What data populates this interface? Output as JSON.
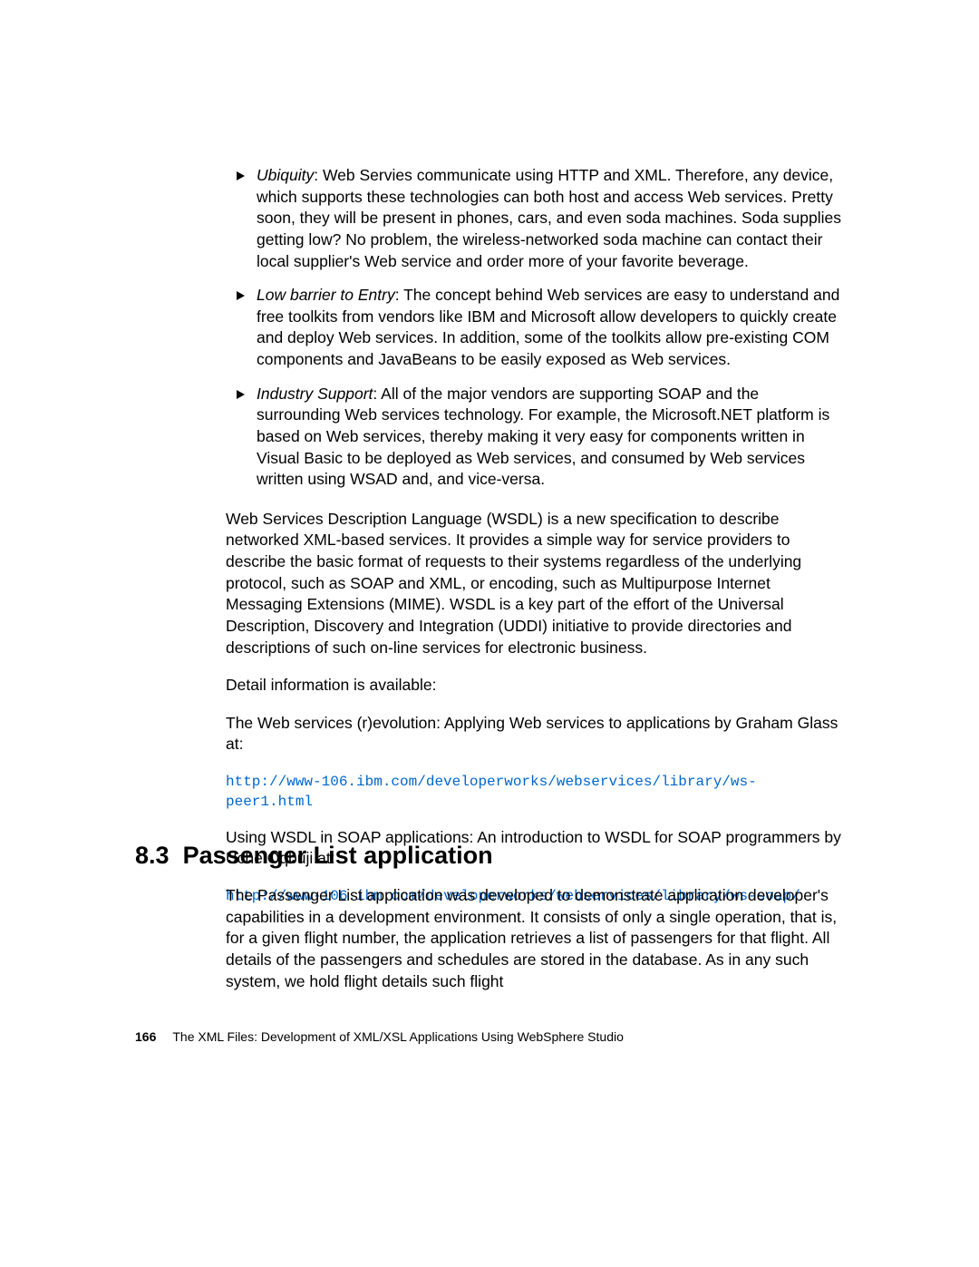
{
  "bullets": [
    {
      "term": "Ubiquity",
      "text": ": Web Servies communicate using HTTP and XML. Therefore, any device, which supports these technologies can both host and access Web services. Pretty soon, they will be present in phones, cars, and even soda machines. Soda supplies getting low? No problem, the wireless-networked soda machine can contact their local supplier's Web service and order more of your favorite beverage."
    },
    {
      "term": "Low barrier to Entry",
      "text": ": The concept behind Web services are easy to understand and free toolkits from vendors like IBM and Microsoft allow developers to quickly create and deploy Web services. In addition, some of the toolkits allow pre-existing COM components and JavaBeans to be easily exposed as Web services."
    },
    {
      "term": "Industry Support",
      "text": ": All of the major vendors are supporting SOAP and the surrounding Web services technology. For example, the Microsoft.NET platform is based on Web services, thereby making it very easy for components written in Visual Basic to be deployed as Web services, and consumed by Web services written using WSAD and, and vice-versa."
    }
  ],
  "paragraphs": {
    "wsdl": "Web Services Description Language (WSDL) is a new specification to describe networked XML-based services. It provides a simple way for service providers to describe the basic format of requests to their systems regardless of the underlying protocol, such as SOAP and XML, or encoding, such as Multipurpose Internet Messaging Extensions (MIME). WSDL is a key part of the effort of the Universal Description, Discovery and Integration (UDDI) initiative to provide directories and descriptions of such on-line services for electronic business.",
    "detail": "Detail information is available:",
    "revolution": "The Web services (r)evolution: Applying Web services to applications by Graham Glass at:",
    "link1": "http://www-106.ibm.com/developerworks/webservices/library/ws-peer1.html",
    "using_wsdl": "Using WSDL in SOAP applications: An introduction to WSDL for SOAP programmers by Uche Oqbuji at:",
    "link2": "http://www-106.ibm.com/developerworks/webservices/library/ws-soap/"
  },
  "section": {
    "number": "8.3",
    "title": "Passenger List application",
    "body": "The Passenger List application was developed to demonstrate application developer's capabilities in a development environment. It consists of only a single operation, that is, for a given flight number, the application retrieves a list of passengers for that flight. All details of the passengers and schedules are stored in the database. As in any such system, we hold flight details such flight"
  },
  "footer": {
    "page": "166",
    "title": "The XML Files:   Development of XML/XSL Applications Using WebSphere Studio"
  }
}
